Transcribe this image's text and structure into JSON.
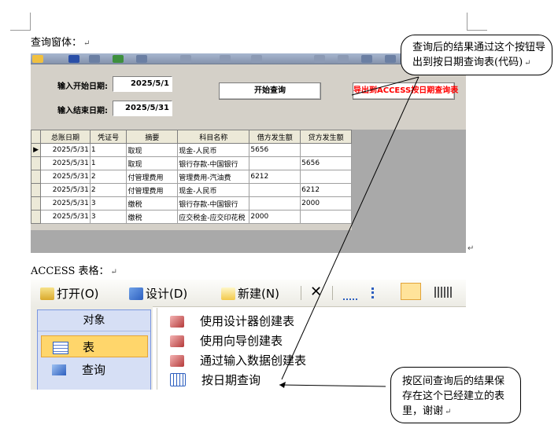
{
  "document": {
    "query_heading": "查询窗体：",
    "access_heading": "ACCESS 表格：",
    "paragraph_mark": "↵"
  },
  "query_form": {
    "start_date_label": "输入开始日期:",
    "start_date_value": "2025/5/1",
    "end_date_label": "输入结束日期:",
    "end_date_value": "2025/5/31",
    "start_query_button": "开始查询",
    "export_button": "导出到ACCESS按日期查询表",
    "grid": {
      "columns": [
        "总账日期",
        "凭证号",
        "摘要",
        "科目名称",
        "借方发生额",
        "贷方发生额"
      ],
      "rows": [
        [
          "2025/5/31",
          "1",
          "取现",
          "现金-人民币",
          "5656",
          ""
        ],
        [
          "2025/5/31",
          "1",
          "取现",
          "银行存款-中国银行",
          "",
          "5656"
        ],
        [
          "2025/5/31",
          "2",
          "付管理费用",
          "管理费用-汽油费",
          "6212",
          ""
        ],
        [
          "2025/5/31",
          "2",
          "付管理费用",
          "现金-人民币",
          "",
          "6212"
        ],
        [
          "2025/5/31",
          "3",
          "缴税",
          "银行存款-中国银行",
          "",
          "2000"
        ],
        [
          "2025/5/31",
          "3",
          "缴税",
          "应交税金-应交印花税",
          "2000",
          ""
        ]
      ],
      "current_row_marker": "▶"
    }
  },
  "access_window": {
    "toolbar": {
      "open": "打开(O)",
      "design": "设计(D)",
      "new": "新建(N)",
      "delete_icon": "✕"
    },
    "objects_title": "对象",
    "objects": [
      "表",
      "查询"
    ],
    "list_items": [
      "使用设计器创建表",
      "使用向导创建表",
      "通过输入数据创建表",
      "按日期查询"
    ]
  },
  "callouts": {
    "top": "查询后的结果通过这个按钮导出到按日期查询表(代码)",
    "bottom": "按区间查询后的结果保存在这个已经建立的表里，谢谢"
  },
  "colors": {
    "export_button_text": "#ff0000",
    "window_face": "#d4d0c8",
    "selected_object": "#ffd66b"
  }
}
